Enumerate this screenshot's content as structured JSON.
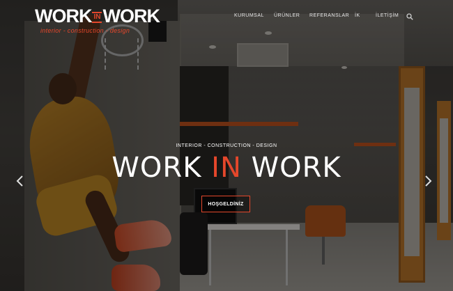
{
  "logo": {
    "word_left": "WORK",
    "word_mid": "IN",
    "word_right": "WORK",
    "tagline": "interior - construction - design"
  },
  "nav": {
    "items": [
      "KURUMSAL",
      "ÜRÜNLER",
      "REFERANSLAR",
      "İK",
      "İLETİŞİM"
    ],
    "search_icon": "search-icon"
  },
  "hero": {
    "kicker": "INTERIOR - CONSTRUCTION - DESIGN",
    "headline_left": "WORK ",
    "headline_accent": "IN",
    "headline_right": " WORK",
    "cta_label": "HOŞGELDİNİZ",
    "prev_icon": "chevron-left-icon",
    "next_icon": "chevron-right-icon"
  },
  "colors": {
    "accent": "#e5472b",
    "text": "#ffffff"
  }
}
